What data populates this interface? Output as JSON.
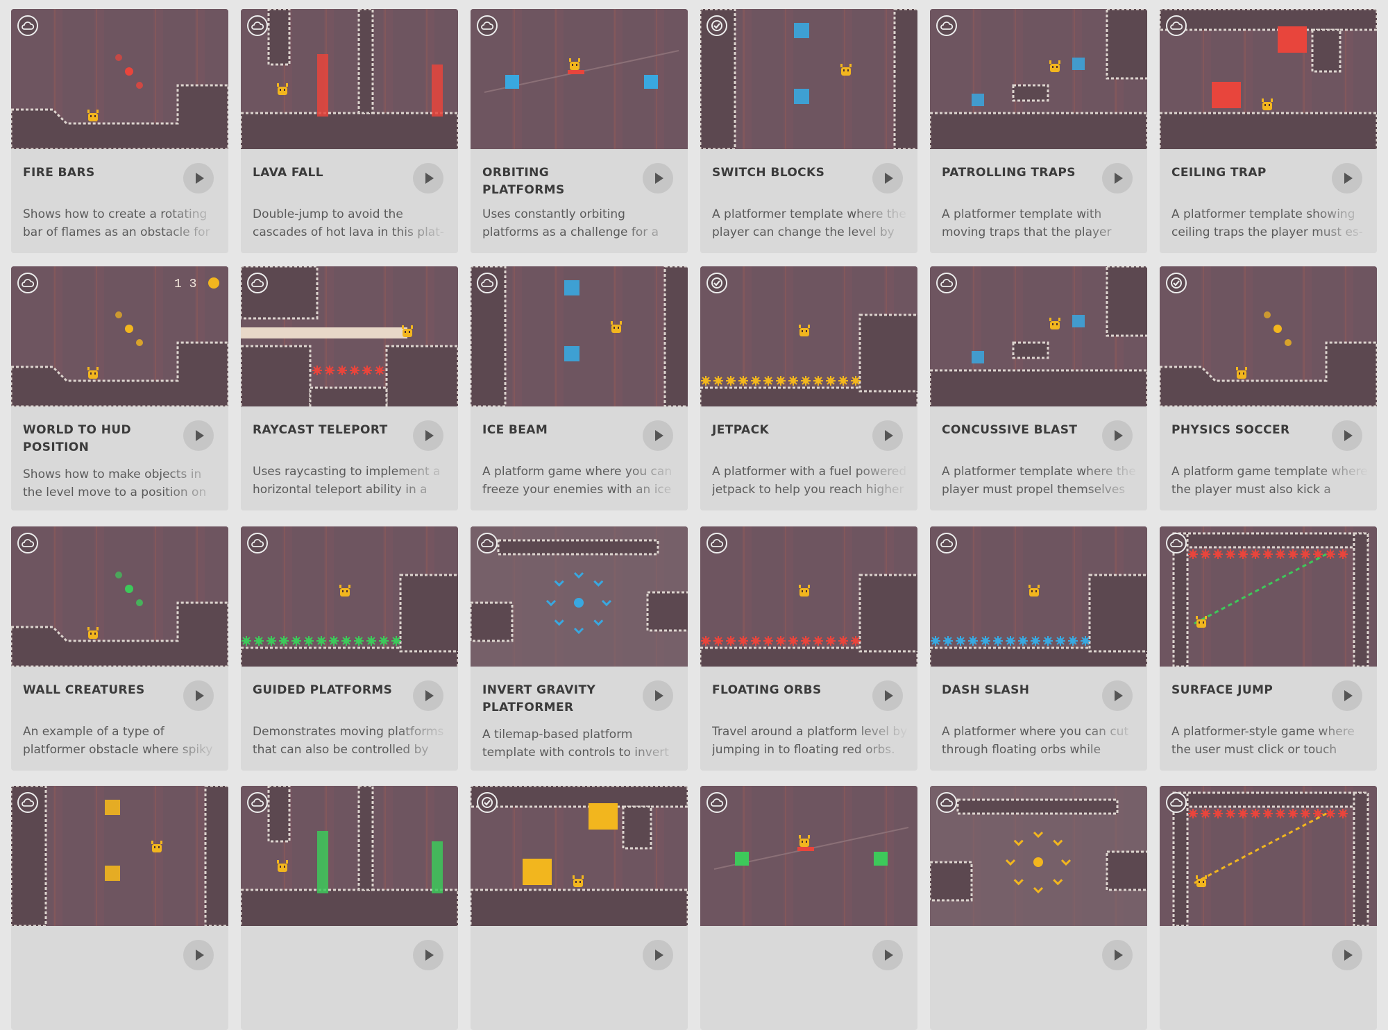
{
  "badge_icons": {
    "cloud": "cloud-icon",
    "check": "check-icon"
  },
  "colors": {
    "thumb_bg": "#6e5560",
    "pillar": "#8a5a5a",
    "wall": "#ddd5cf",
    "lava": "#e8453c",
    "player": "#f2b61e",
    "ice": "#39a8e0",
    "green": "#3dc95a"
  },
  "cards": [
    {
      "title": "FIRE BARS",
      "description": "Shows how to create a rotating bar of flames as an obstacle for a",
      "badge": "cloud",
      "accent": "#e8453c",
      "scene": "ledge"
    },
    {
      "title": "LAVA FALL",
      "description": "Double-jump to avoid the cascades of hot lava in this plat-",
      "badge": "cloud",
      "accent": "#e8453c",
      "scene": "towers"
    },
    {
      "title": "ORBITING PLATFORMS",
      "description": "Uses constantly orbiting platforms as a challenge for a plat-",
      "badge": "cloud",
      "accent": "#39a8e0",
      "scene": "open"
    },
    {
      "title": "SWITCH BLOCKS",
      "description": "A platformer template where the player can change the level by",
      "badge": "check",
      "accent": "#39a8e0",
      "scene": "walls"
    },
    {
      "title": "PATROLLING TRAPS",
      "description": "A platformer template with moving traps that the player must",
      "badge": "cloud",
      "accent": "#39a8e0",
      "scene": "blocks"
    },
    {
      "title": "CEILING TRAP",
      "description": "A platformer template showing ceiling traps the player must es-",
      "badge": "cloud",
      "accent": "#e8453c",
      "scene": "ceiling"
    },
    {
      "title": "WORLD TO HUD POSITION",
      "description": "Shows how to make objects in the level move to a position on",
      "badge": "cloud",
      "accent": "#f2b61e",
      "scene": "ledge",
      "hud": "1  3"
    },
    {
      "title": "RAYCAST TELEPORT",
      "description": "Uses raycasting to implement a horizontal teleport ability in a",
      "badge": "cloud",
      "accent": "#e8453c",
      "scene": "pit"
    },
    {
      "title": "ICE BEAM",
      "description": "A platform game where you can freeze your enemies with an ice",
      "badge": "cloud",
      "accent": "#39a8e0",
      "scene": "walls"
    },
    {
      "title": "JETPACK",
      "description": "A platformer with a fuel powered jetpack to help you reach higher",
      "badge": "check",
      "accent": "#f2b61e",
      "scene": "spikes"
    },
    {
      "title": "CONCUSSIVE BLAST",
      "description": "A platformer template where the player must propel themselves",
      "badge": "cloud",
      "accent": "#39a8e0",
      "scene": "blocks"
    },
    {
      "title": "PHYSICS SOCCER",
      "description": "A platform game template where the player must also kick a",
      "badge": "check",
      "accent": "#f2b61e",
      "scene": "ledge"
    },
    {
      "title": "WALL CREATURES",
      "description": "An example of a type of platformer obstacle where spiky",
      "badge": "cloud",
      "accent": "#3dc95a",
      "scene": "ledge"
    },
    {
      "title": "GUIDED PLATFORMS",
      "description": "Demonstrates moving platforms that can also be controlled by the",
      "badge": "cloud",
      "accent": "#3dc95a",
      "scene": "spikes"
    },
    {
      "title": "INVERT GRAVITY PLATFORMER",
      "description": "A tilemap-based platform template with controls to invert grav",
      "badge": "cloud",
      "accent": "#39a8e0",
      "scene": "blur"
    },
    {
      "title": "FLOATING ORBS",
      "description": "Travel around a platform level by jumping in to floating red orbs.",
      "badge": "cloud",
      "accent": "#e8453c",
      "scene": "spikes"
    },
    {
      "title": "DASH SLASH",
      "description": "A platformer where you can cut through floating orbs while",
      "badge": "cloud",
      "accent": "#39a8e0",
      "scene": "spikes"
    },
    {
      "title": "SURFACE JUMP",
      "description": "A platformer-style game where the user must click or touch",
      "badge": "cloud",
      "accent": "#3dc95a",
      "scene": "room"
    },
    {
      "title": "",
      "description": "",
      "badge": "cloud",
      "accent": "#f2b61e",
      "scene": "walls"
    },
    {
      "title": "",
      "description": "",
      "badge": "cloud",
      "accent": "#3dc95a",
      "scene": "towers"
    },
    {
      "title": "",
      "description": "",
      "badge": "check",
      "accent": "#f2b61e",
      "scene": "ceiling"
    },
    {
      "title": "",
      "description": "",
      "badge": "cloud",
      "accent": "#3dc95a",
      "scene": "open"
    },
    {
      "title": "",
      "description": "",
      "badge": "cloud",
      "accent": "#f2b61e",
      "scene": "blur"
    },
    {
      "title": "",
      "description": "",
      "badge": "cloud",
      "accent": "#f2b61e",
      "scene": "room"
    }
  ]
}
